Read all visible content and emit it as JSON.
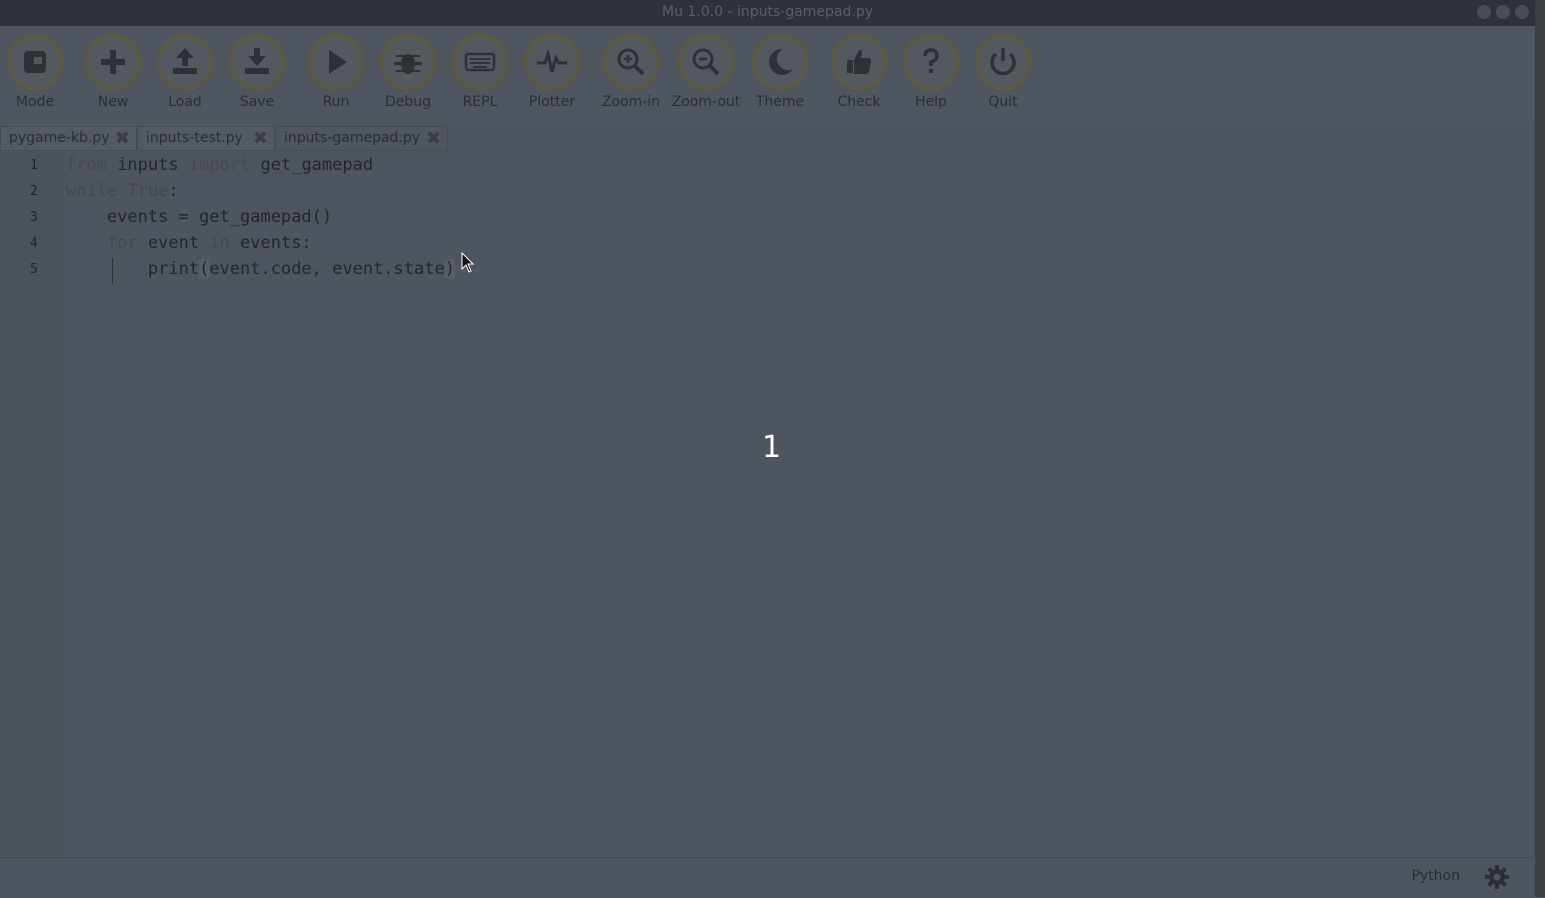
{
  "window": {
    "title": "Mu 1.0.0 - inputs-gamepad.py"
  },
  "toolbar": {
    "buttons": [
      {
        "label": "Mode",
        "icon": "mode-icon"
      },
      {
        "label": "New",
        "icon": "plus-icon"
      },
      {
        "label": "Load",
        "icon": "upload-icon"
      },
      {
        "label": "Save",
        "icon": "download-icon"
      },
      {
        "label": "Run",
        "icon": "play-icon"
      },
      {
        "label": "Debug",
        "icon": "bug-icon"
      },
      {
        "label": "REPL",
        "icon": "keyboard-icon"
      },
      {
        "label": "Plotter",
        "icon": "pulse-icon"
      },
      {
        "label": "Zoom-in",
        "icon": "zoom-in-icon"
      },
      {
        "label": "Zoom-out",
        "icon": "zoom-out-icon"
      },
      {
        "label": "Theme",
        "icon": "moon-icon"
      },
      {
        "label": "Check",
        "icon": "thumbs-up-icon"
      },
      {
        "label": "Help",
        "icon": "question-icon"
      },
      {
        "label": "Quit",
        "icon": "power-icon"
      }
    ]
  },
  "tabs": [
    {
      "label": "pygame-kb.py"
    },
    {
      "label": "inputs-test.py"
    },
    {
      "label": "inputs-gamepad.py",
      "active": true
    }
  ],
  "editor": {
    "line_numbers": [
      "1",
      "2",
      "3",
      "4",
      "5"
    ],
    "lines": [
      {
        "t1": "from",
        "t2": " inputs ",
        "t3": "import",
        "t4": " get_gamepad"
      },
      {
        "t1": "while",
        "t2": " ",
        "t3": "True",
        "t4": ":"
      },
      {
        "t1": "    events = get_gamepad",
        "t2": "()"
      },
      {
        "t1": "    ",
        "t2": "for",
        "t3": " event ",
        "t4": "in",
        "t5": " events:"
      },
      {
        "t1": "        print",
        "t2": "(",
        "t3": "event.code, event.state",
        "t4": ")"
      }
    ]
  },
  "overlay": {
    "number": "1"
  },
  "status": {
    "mode": "Python"
  }
}
